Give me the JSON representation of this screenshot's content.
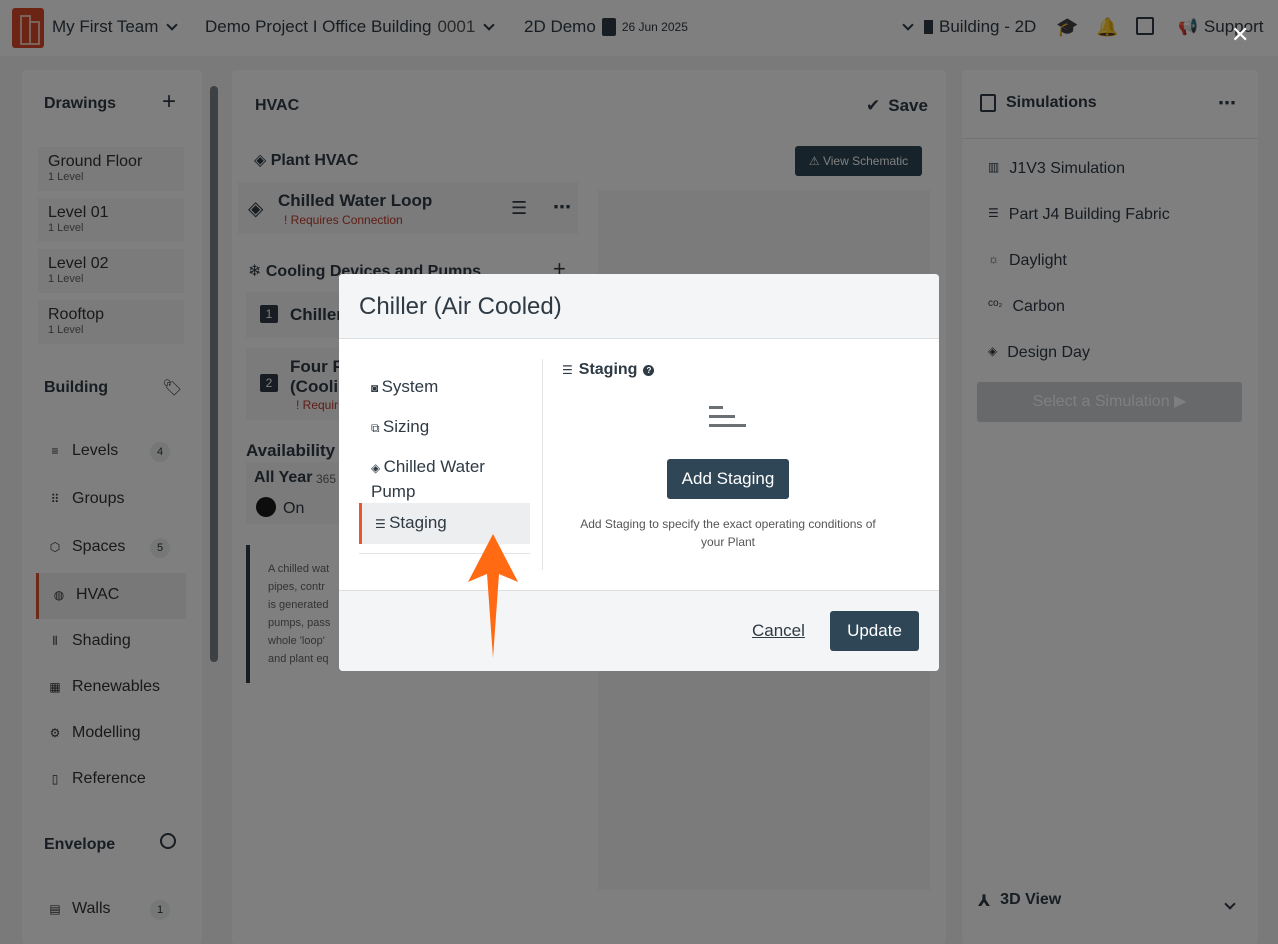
{
  "topbar": {
    "team": "My First Team",
    "project": "Demo Project I Office Building",
    "project_num": "0001",
    "demo": "2D Demo",
    "date": "26 Jun 2025",
    "view": "Building - 2D",
    "support": "Support"
  },
  "sidebar": {
    "drawings_title": "Drawings",
    "levels": [
      {
        "name": "Ground Floor",
        "sub": "1 Level"
      },
      {
        "name": "Level 01",
        "sub": "1 Level"
      },
      {
        "name": "Level 02",
        "sub": "1 Level"
      },
      {
        "name": "Rooftop",
        "sub": "1 Level"
      }
    ],
    "building_title": "Building",
    "nav": [
      {
        "label": "Levels",
        "count": "4"
      },
      {
        "label": "Groups"
      },
      {
        "label": "Spaces",
        "count": "5"
      },
      {
        "label": "HVAC"
      },
      {
        "label": "Shading"
      },
      {
        "label": "Renewables"
      },
      {
        "label": "Modelling"
      },
      {
        "label": "Reference"
      }
    ],
    "envelope_title": "Envelope",
    "walls": {
      "label": "Walls",
      "count": "1"
    }
  },
  "mid": {
    "title": "HVAC",
    "save": "Save",
    "plant": "Plant HVAC",
    "view_schematic": "View Schematic",
    "loop_title": "Chilled Water Loop",
    "loop_warning": "! Requires Connection",
    "cooling": "Cooling Devices and Pumps",
    "item1": "Chiller",
    "item2_a": "Four P",
    "item2_b": "(Coolin",
    "item2_warn": "! Requir",
    "availability": "Availability",
    "all_year": "All Year",
    "all_year_num": "365",
    "on": "On",
    "desc": [
      "A chilled wat",
      "pipes, contr",
      "is generated",
      "pumps, pass",
      "whole 'loop'",
      "and plant eq"
    ]
  },
  "right": {
    "title": "Simulations",
    "items": [
      "J1V3 Simulation",
      "Part J4 Building Fabric",
      "Daylight",
      "Carbon",
      "Design Day"
    ],
    "select_btn": "Select a Simulation",
    "view3d": "3D View"
  },
  "modal": {
    "title": "Chiller (Air Cooled)",
    "nav": [
      "System",
      "Sizing",
      "Chilled Water Pump",
      "Staging"
    ],
    "section": "Staging",
    "add_btn": "Add Staging",
    "help": "Add Staging to specify the exact operating conditions of your Plant",
    "cancel": "Cancel",
    "update": "Update"
  },
  "colors": {
    "accent": "#e8572a",
    "dark_button": "#2e4656",
    "arrow": "#ff6a13"
  }
}
